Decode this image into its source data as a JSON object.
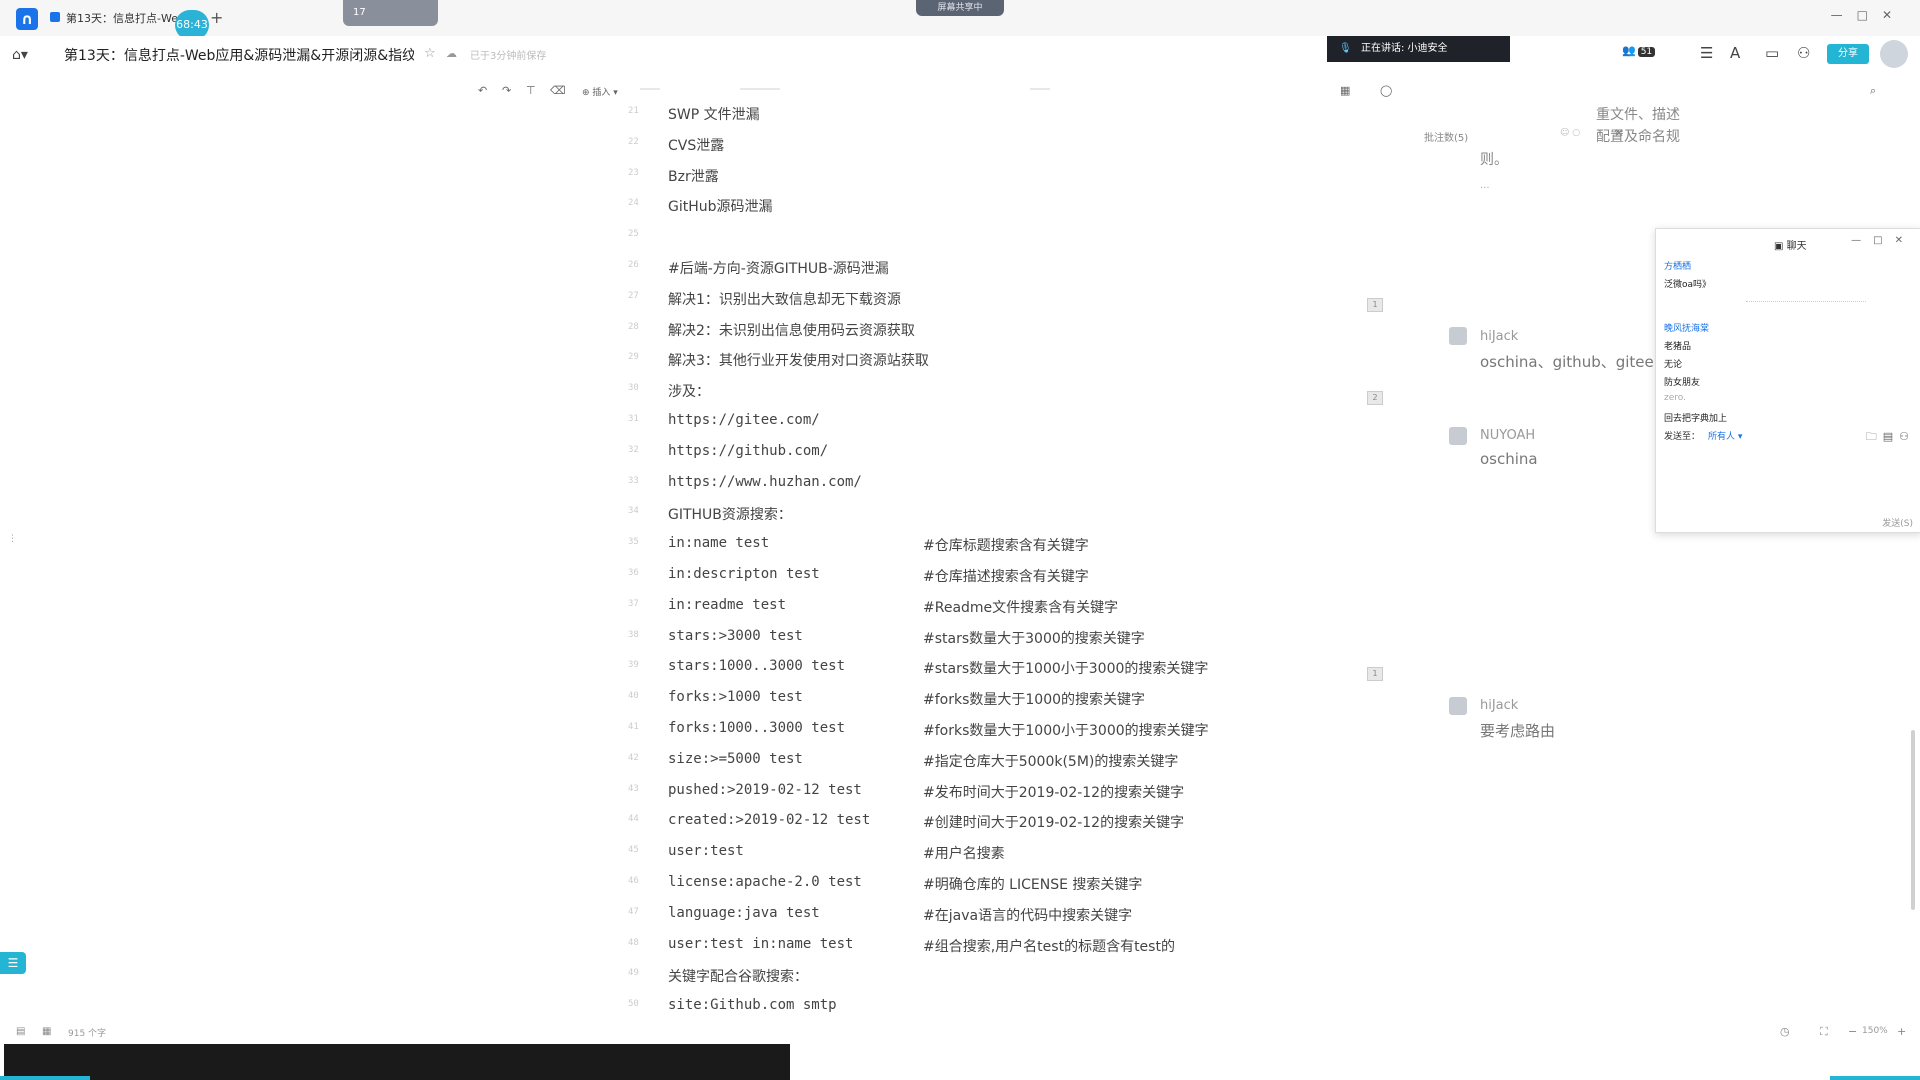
{
  "window": {
    "tab_title": "第13天：信息打点-Web...",
    "timer": "68:43",
    "new_tab": "+",
    "widget_text": "17",
    "share_pill": "屏幕共享中"
  },
  "header": {
    "doc_title": "第13天：信息打点-Web应用&源码泄漏&开源闭源&指纹...",
    "saved_status": "已于3分钟前保存",
    "speaking": "正在讲话: 小迪安全",
    "user_count": "51",
    "share_label": "分享"
  },
  "toolbar": {
    "insert_label": "插入"
  },
  "editor": {
    "lines": [
      {
        "num": "21",
        "code": "SWP 文件泄漏",
        "comment": ""
      },
      {
        "num": "22",
        "code": "CVS泄露",
        "comment": ""
      },
      {
        "num": "23",
        "code": "Bzr泄露",
        "comment": ""
      },
      {
        "num": "24",
        "code": "GitHub源码泄漏",
        "comment": ""
      },
      {
        "num": "25",
        "code": "",
        "comment": ""
      },
      {
        "num": "26",
        "code": "#后端-方向-资源GITHUB-源码泄漏",
        "comment": ""
      },
      {
        "num": "27",
        "code": "解决1：识别出大致信息却无下载资源",
        "comment": ""
      },
      {
        "num": "28",
        "code": "解决2：未识别出信息使用码云资源获取",
        "comment": ""
      },
      {
        "num": "29",
        "code": "解决3：其他行业开发使用对口资源站获取",
        "comment": ""
      },
      {
        "num": "30",
        "code": "涉及：",
        "comment": ""
      },
      {
        "num": "31",
        "code": "https://gitee.com/",
        "comment": ""
      },
      {
        "num": "32",
        "code": "https://github.com/",
        "comment": ""
      },
      {
        "num": "33",
        "code": "https://www.huzhan.com/",
        "comment": ""
      },
      {
        "num": "34",
        "code": "GITHUB资源搜索：",
        "comment": ""
      },
      {
        "num": "35",
        "code": "in:name test",
        "comment": "#仓库标题搜索含有关键字"
      },
      {
        "num": "36",
        "code": "in:descripton test",
        "comment": "#仓库描述搜索含有关键字"
      },
      {
        "num": "37",
        "code": "in:readme test",
        "comment": "#Readme文件搜素含有关键字"
      },
      {
        "num": "38",
        "code": "stars:>3000 test",
        "comment": "#stars数量大于3000的搜索关键字"
      },
      {
        "num": "39",
        "code": "stars:1000..3000 test",
        "comment": "#stars数量大于1000小于3000的搜索关键字"
      },
      {
        "num": "40",
        "code": "forks:>1000 test",
        "comment": "#forks数量大于1000的搜索关键字"
      },
      {
        "num": "41",
        "code": "forks:1000..3000 test",
        "comment": "#forks数量大于1000小于3000的搜索关键字"
      },
      {
        "num": "42",
        "code": "size:>=5000 test",
        "comment": "#指定仓库大于5000k(5M)的搜索关键字"
      },
      {
        "num": "43",
        "code": "pushed:>2019-02-12 test",
        "comment": "#发布时间大于2019-02-12的搜索关键字"
      },
      {
        "num": "44",
        "code": "created:>2019-02-12 test",
        "comment": "#创建时间大于2019-02-12的搜索关键字"
      },
      {
        "num": "45",
        "code": "user:test",
        "comment": "#用户名搜素"
      },
      {
        "num": "46",
        "code": "license:apache-2.0 test",
        "comment": "#明确仓库的 LICENSE 搜索关键字"
      },
      {
        "num": "47",
        "code": "language:java test",
        "comment": "#在java语言的代码中搜索关键字"
      },
      {
        "num": "48",
        "code": "user:test in:name test",
        "comment": "#组合搜索,用户名test的标题含有test的"
      },
      {
        "num": "49",
        "code": "关键字配合谷歌搜索：",
        "comment": ""
      },
      {
        "num": "50",
        "code": "site:Github.com smtp",
        "comment": ""
      }
    ]
  },
  "comments": {
    "title": "批注数(5)",
    "snippet_a": "重文件、描述",
    "snippet_b": "配置及命名规",
    "snippet_c": "则。",
    "snippet_d": "...",
    "items": [
      {
        "author": "hiJack",
        "text": "oschina、github、gitee"
      },
      {
        "author": "NUYOAH",
        "text": "oschina"
      },
      {
        "author": "hiJack",
        "text": "要考虑路由"
      }
    ]
  },
  "chat": {
    "title": "聊天",
    "messages": [
      {
        "text": "方栖栖",
        "style": "name"
      },
      {
        "text": "泛微oa吗》",
        "style": ""
      },
      {
        "text": "晚风抚海棠",
        "style": "name"
      },
      {
        "text": "老猪品",
        "style": ""
      },
      {
        "text": "无论",
        "style": ""
      },
      {
        "text": "防女朋友",
        "style": ""
      },
      {
        "text": "zero.",
        "style": "faint"
      },
      {
        "text": "回去把字典加上",
        "style": ""
      }
    ],
    "send_to_label": "发送至：",
    "recipient": "所有人",
    "send_button": "发送(S)"
  },
  "footer": {
    "word_count": "915 个字",
    "zoom": "150%"
  },
  "colors": {
    "accent": "#23b5d3",
    "dark_bar": "#1a1a1a"
  }
}
